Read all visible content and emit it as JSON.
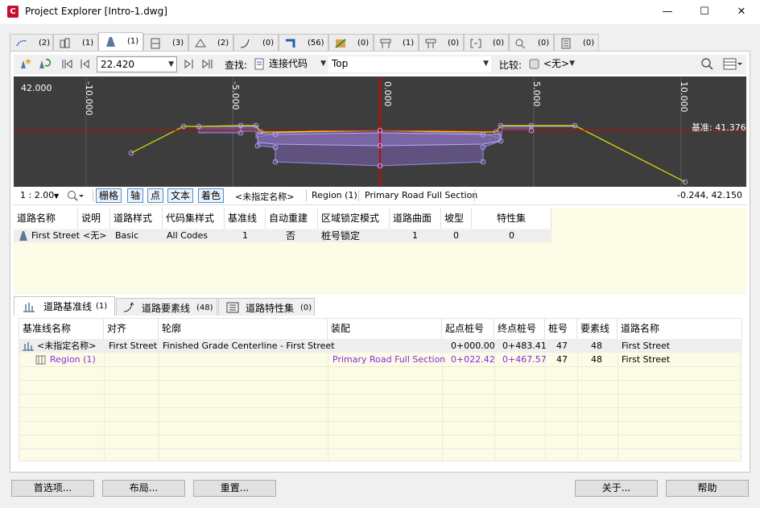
{
  "window": {
    "title": "Project Explorer [Intro-1.dwg]",
    "minimize": "—",
    "maximize": "☐",
    "close": "✕"
  },
  "object_tabs": [
    {
      "icon": "alignment-icon",
      "count": "(2)"
    },
    {
      "icon": "profile-icon",
      "count": "(1)"
    },
    {
      "icon": "corridor-icon",
      "count": "(1)"
    },
    {
      "icon": "section-icon",
      "count": "(3)"
    },
    {
      "icon": "surface-icon",
      "count": "(2)"
    },
    {
      "icon": "feature-line-icon",
      "count": "(0)"
    },
    {
      "icon": "pipe-icon",
      "count": "(56)"
    },
    {
      "icon": "parcel-icon",
      "count": "(0)"
    },
    {
      "icon": "structure-icon",
      "count": "(1)"
    },
    {
      "icon": "structure2-icon",
      "count": "(0)"
    },
    {
      "icon": "bracket-icon",
      "count": "(0)"
    },
    {
      "icon": "point-icon",
      "count": "(0)"
    },
    {
      "icon": "sheet-icon",
      "count": "(0)"
    }
  ],
  "toolbar": {
    "station_value": "22.420",
    "find_label": "查找:",
    "find_combo": "连接代码",
    "find_value": "Top",
    "compare_label": "比较:",
    "compare_value": "<无>"
  },
  "viewport": {
    "y_label": "42.000",
    "x_ticks": [
      "-10.000",
      "-5.000",
      "0.000",
      "5.000",
      "10.000"
    ],
    "datum_label": "基准: 41.376"
  },
  "statusbar": {
    "scale": "1 : 2.00",
    "buttons": [
      "栅格",
      "轴",
      "点",
      "文本",
      "着色"
    ],
    "name": "<未指定名称>",
    "region": "Region (1)",
    "assembly": "Primary Road Full Section",
    "coords": "-0.244, 42.150"
  },
  "corridor_grid": {
    "headers": [
      "道路名称",
      "说明",
      "道路样式",
      "代码集样式",
      "基准线",
      "自动重建",
      "区域锁定模式",
      "道路曲面",
      "坡型",
      "特性集"
    ],
    "row": [
      "First Street",
      "<无>",
      "Basic",
      "All Codes",
      "1",
      "否",
      "桩号锁定",
      "1",
      "0",
      "0"
    ]
  },
  "sub_tabs": [
    {
      "label": "道路基准线",
      "count": "(1)"
    },
    {
      "label": "道路要素线",
      "count": "(48)"
    },
    {
      "label": "道路特性集",
      "count": "(0)"
    }
  ],
  "baseline_grid": {
    "headers": [
      "基准线名称",
      "对齐",
      "轮廓",
      "装配",
      "起点桩号",
      "终点桩号",
      "桩号",
      "要素线",
      "道路名称"
    ],
    "rows": [
      [
        "<未指定名称>",
        "First Street",
        "Finished Grade Centerline - First Street",
        "",
        "0+000.00",
        "0+483.41",
        "47",
        "48",
        "First Street"
      ],
      [
        "Region (1)",
        "",
        "",
        "Primary Road Full Section",
        "0+022.42",
        "0+467.57",
        "47",
        "48",
        "First Street"
      ]
    ]
  },
  "bottom_buttons": {
    "preferences": "首选项...",
    "layout": "布局...",
    "reset": "重置...",
    "about": "关于...",
    "help": "帮助"
  }
}
